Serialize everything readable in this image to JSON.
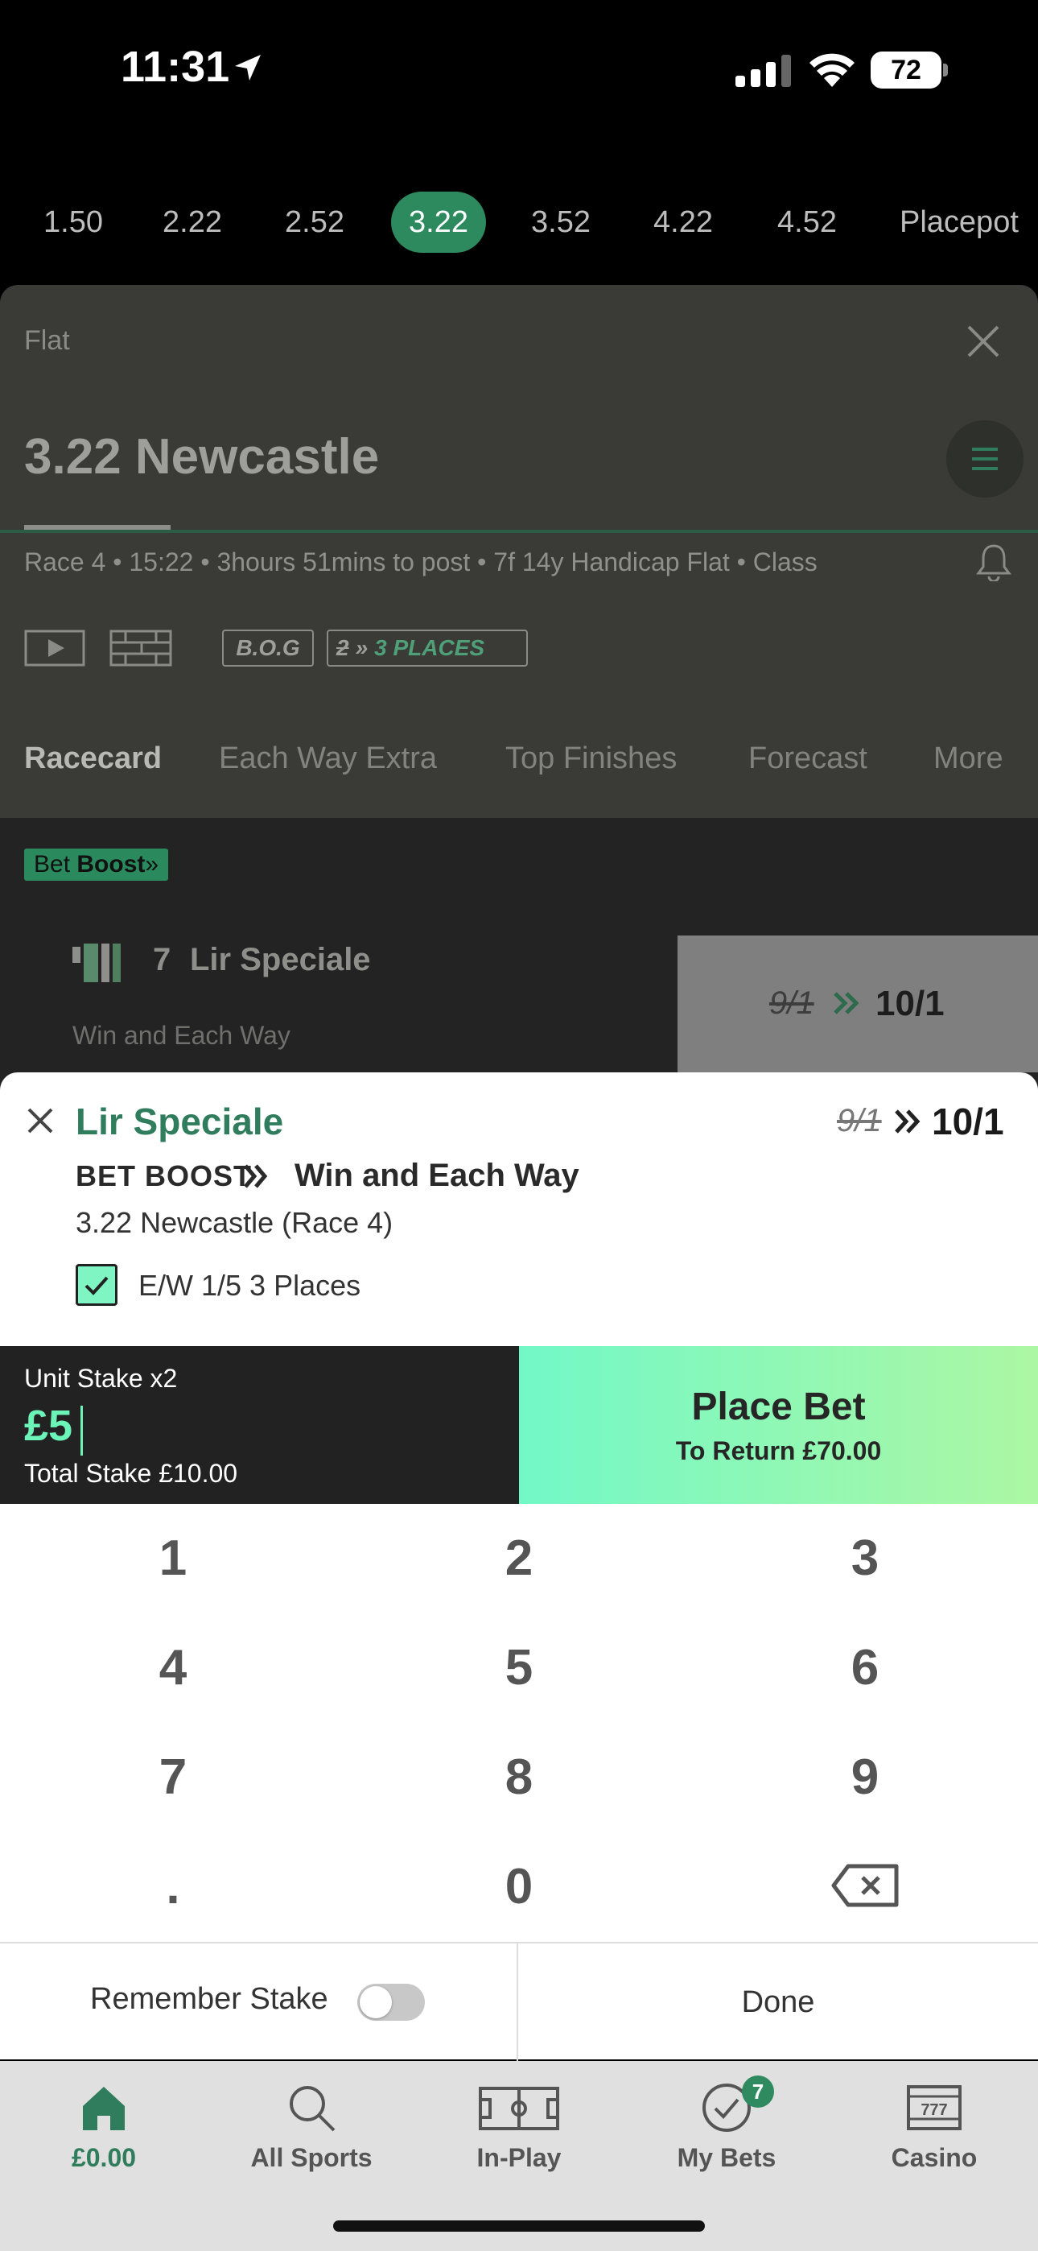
{
  "status_bar": {
    "time": "11:31",
    "battery": "72"
  },
  "race_times": [
    "1.50",
    "2.22",
    "2.52",
    "3.22",
    "3.52",
    "4.22",
    "4.52",
    "Placepot"
  ],
  "race_times_active_index": 3,
  "race": {
    "type": "Flat",
    "title": "3.22 Newcastle",
    "info": "Race 4 • 15:22 • 3hours 51mins to post • 7f 14y Handicap Flat • Class",
    "bog_label": "B.O.G",
    "places_old": "2",
    "places_new": "3 PLACES"
  },
  "tabs": [
    "Racecard",
    "Each Way Extra",
    "Top Finishes",
    "Forecast",
    "More"
  ],
  "runner": {
    "boost_prefix": "Bet",
    "boost_bold": "Boost",
    "number": "7",
    "name": "Lir Speciale",
    "market": "Win and Each Way",
    "odds_old": "9/1",
    "odds_new": "10/1"
  },
  "bet_slip": {
    "runner": "Lir Speciale",
    "odds_old": "9/1",
    "odds_new": "10/1",
    "boost_label": "BET BOOST",
    "market": "Win and Each Way",
    "event": "3.22 Newcastle (Race 4)",
    "ew_label": "E/W  1/5  3 Places",
    "unit_stake_label": "Unit Stake x2",
    "stake_value": "£5",
    "total_stake": "Total Stake  £10.00",
    "place_bet_label": "Place Bet",
    "to_return": "To Return £70.00"
  },
  "keypad": [
    "1",
    "2",
    "3",
    "4",
    "5",
    "6",
    "7",
    "8",
    "9",
    ".",
    "0"
  ],
  "keypad_footer": {
    "remember_stake": "Remember Stake",
    "done": "Done"
  },
  "nav": {
    "home": "£0.00",
    "all_sports": "All Sports",
    "in_play": "In-Play",
    "my_bets": "My Bets",
    "my_bets_badge": "7",
    "casino": "Casino"
  },
  "colors": {
    "brand_green": "#2f7d5c",
    "accent_mint": "#6cf3b8"
  }
}
